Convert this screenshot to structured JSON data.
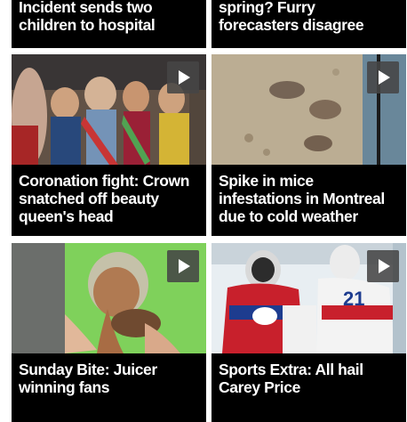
{
  "tiles": [
    {
      "title_lines": [
        "Incident sends two",
        "children to hospital"
      ]
    },
    {
      "title_lines": [
        "spring? Furry",
        "forecasters disagree"
      ]
    },
    {
      "title_lines": [
        "Coronation fight: Crown",
        "snatched off beauty",
        "queen's head"
      ],
      "play_icon": "play-icon"
    },
    {
      "title_lines": [
        "Spike in mice",
        "infestations in Montreal",
        "due to cold weather"
      ],
      "play_icon": "play-icon"
    },
    {
      "title_lines": [
        "Sunday Bite: Juicer",
        "winning fans"
      ],
      "play_icon": "play-icon"
    },
    {
      "title_lines": [
        "Sports Extra: All hail",
        "Carey Price"
      ],
      "play_icon": "play-icon"
    }
  ],
  "colors": {
    "caption_bg": "#000000",
    "caption_text": "#ffffff",
    "play_bg": "#464646"
  }
}
